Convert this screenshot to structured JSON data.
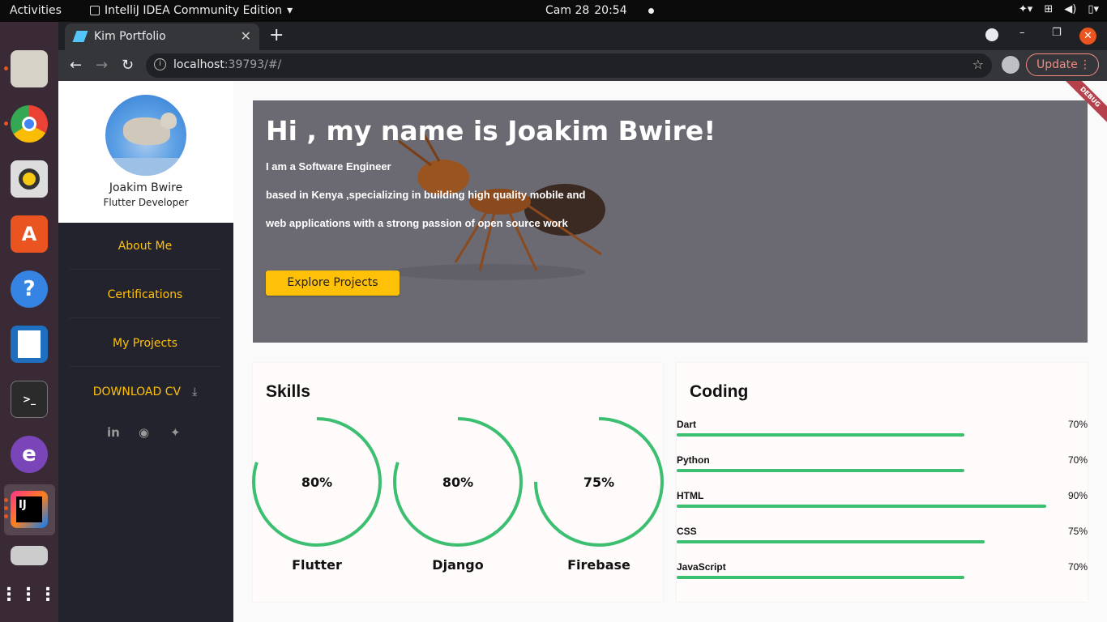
{
  "os": {
    "activities_label": "Activities",
    "app_menu_label": "IntelliJ IDEA Community Edition",
    "clock": {
      "day": "Cam 28",
      "time": "20:54"
    }
  },
  "browser": {
    "tab_title": "Kim Portfolio",
    "url_host": "localhost",
    "url_rest": ":39793/#/",
    "update_label": "Update"
  },
  "profile": {
    "name": "Joakim Bwire",
    "role": "Flutter Developer"
  },
  "nav": {
    "about": "About Me",
    "certifications": "Certifications",
    "projects": "My Projects",
    "download_cv": "DOWNLOAD CV"
  },
  "hero": {
    "title": "Hi , my name is Joakim Bwire!",
    "line1": "I am a Software Engineer",
    "line2": "based in Kenya ,specializing in building high quality mobile and",
    "line3": "web applications with a strong passion of open source work",
    "button_label": "Explore Projects"
  },
  "skills": {
    "title": "Skills",
    "items": [
      {
        "name": "Flutter",
        "percent_label": "80%",
        "value": 0.8
      },
      {
        "name": "Django",
        "percent_label": "80%",
        "value": 0.8
      },
      {
        "name": "Firebase",
        "percent_label": "75%",
        "value": 0.75
      }
    ]
  },
  "coding": {
    "title": "Coding",
    "items": [
      {
        "name": "Dart",
        "percent_label": "70%",
        "value": 0.7
      },
      {
        "name": "Python",
        "percent_label": "70%",
        "value": 0.7
      },
      {
        "name": "HTML",
        "percent_label": "90%",
        "value": 0.9
      },
      {
        "name": "CSS",
        "percent_label": "75%",
        "value": 0.75
      },
      {
        "name": "JavaScript",
        "percent_label": "70%",
        "value": 0.7
      }
    ]
  },
  "debug_banner": "DEBUG",
  "colors": {
    "accent": "#ffc107",
    "progress": "#3cbf70",
    "sidebar": "#23232e",
    "hero_overlay": "#6b6a72"
  }
}
